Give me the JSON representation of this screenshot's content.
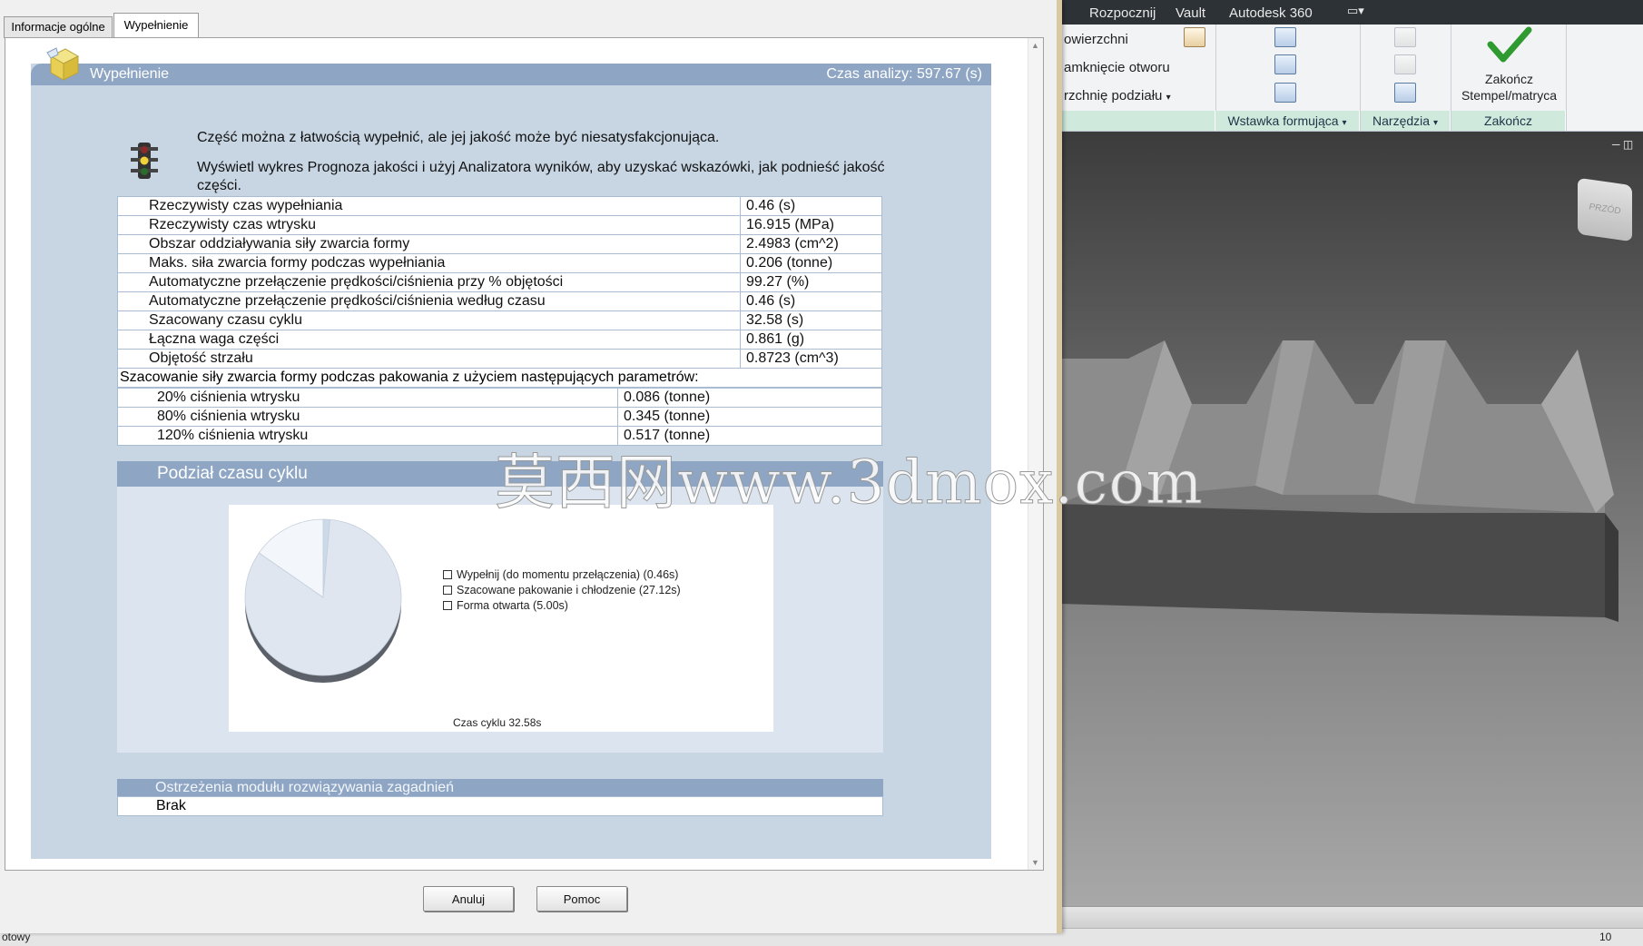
{
  "dialog": {
    "tabs": [
      {
        "label": "Informacje ogólne"
      },
      {
        "label": "Wypełnienie"
      }
    ],
    "header": {
      "title": "Wypełnienie",
      "analysis_time": "Czas analizy: 597.67 (s)"
    },
    "messages": [
      "Część można z łatwością wypełnić, ale jej jakość może być niesatysfakcjonująca.",
      "Wyświetl wykres Prognoza jakości i użyj Analizatora wyników, aby uzyskać wskazówki, jak podnieść jakość części."
    ],
    "results": [
      {
        "label": "Rzeczywisty czas wypełniania",
        "value": "0.46 (s)"
      },
      {
        "label": "Rzeczywisty czas wtrysku",
        "value": "16.915 (MPa)"
      },
      {
        "label": "Obszar oddziaływania siły zwarcia formy",
        "value": "2.4983 (cm^2)"
      },
      {
        "label": "Maks. siła zwarcia formy podczas wypełniania",
        "value": "0.206 (tonne)"
      },
      {
        "label": "Automatyczne przełączenie prędkości/ciśnienia przy % objętości",
        "value": "99.27 (%)"
      },
      {
        "label": "Automatyczne przełączenie prędkości/ciśnienia według czasu",
        "value": "0.46 (s)"
      },
      {
        "label": "Szacowany czasu cyklu",
        "value": "32.58 (s)"
      },
      {
        "label": "Łączna waga części",
        "value": "0.861 (g)"
      },
      {
        "label": "Objętość strzału",
        "value": "0.8723 (cm^3)"
      }
    ],
    "clamp": {
      "heading": "Szacowanie siły zwarcia formy podczas pakowania z użyciem następujących parametrów:",
      "rows": [
        {
          "label": "20% ciśnienia wtrysku",
          "value": "0.086 (tonne)"
        },
        {
          "label": "80% ciśnienia wtrysku",
          "value": "0.345 (tonne)"
        },
        {
          "label": "120% ciśnienia wtrysku",
          "value": "0.517 (tonne)"
        }
      ]
    },
    "cycle_section": {
      "title": "Podział czasu cyklu"
    },
    "warnings": {
      "title": "Ostrzeżenia modułu rozwiązywania zagadnień",
      "value": "Brak"
    },
    "buttons": {
      "cancel": "Anuluj",
      "help": "Pomoc"
    }
  },
  "chart_data": {
    "type": "pie",
    "title": "",
    "slices": [
      {
        "label": "Wypełnij (do momentu przełączenia) (0.46s)",
        "value": 0.46
      },
      {
        "label": "Szacowane pakowanie i chłodzenie (27.12s)",
        "value": 27.12
      },
      {
        "label": "Forma otwarta (5.00s)",
        "value": 5.0
      }
    ],
    "total_label": "Czas cyklu 32.58s",
    "legend": "right",
    "colors": [
      "#ccd9e8",
      "#dfe6ef",
      "#f3f6fa"
    ]
  },
  "ribbon": {
    "tabs": [
      "Rozpocznij",
      "Vault",
      "Autodesk 360"
    ],
    "left_items": [
      "owierzchni",
      "amknięcie otworu",
      "rzchnię podziału"
    ],
    "panels": [
      {
        "title": "Wstawka formująca"
      },
      {
        "title": "Narzędzia"
      },
      {
        "title": "Zakończ"
      }
    ],
    "finish_button": {
      "line1": "Zakończ",
      "line2": "Stempel/matryca"
    }
  },
  "viewcube": {
    "label": "PRZÓD"
  },
  "watermark": "莫西网www.3dmox.com",
  "status": {
    "left": "otowy",
    "right": "10"
  }
}
